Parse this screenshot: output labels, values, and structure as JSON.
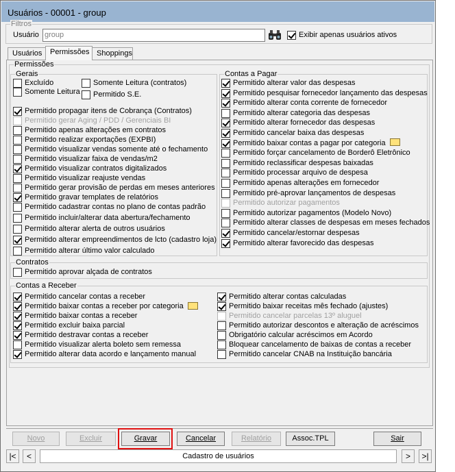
{
  "window": {
    "title": "Usuários - 00001 - group"
  },
  "filtros": {
    "legend": "Filtros",
    "usuario_label": "Usuário",
    "usuario_value": "group",
    "ativos_label": "Exibir apenas usuários ativos",
    "ativos_checked": true
  },
  "tabs": [
    "Usuários",
    "Permissões",
    "Shoppings"
  ],
  "permissoes": {
    "legend": "Permissões",
    "gerais": {
      "legend": "Gerais",
      "top": [
        {
          "label": "Excluído",
          "checked": false
        },
        {
          "label": "Somente Leitura",
          "checked": false
        },
        {
          "label": "Somente Leitura (contratos)",
          "checked": false
        },
        {
          "label": "Permitido S.E.",
          "checked": false
        }
      ],
      "items": [
        {
          "label": "Permitido propagar itens de Cobrança (Contratos)",
          "checked": true,
          "disabled": false
        },
        {
          "label": "Permitido gerar Aging / PDD / Gerenciais BI",
          "checked": false,
          "disabled": true
        },
        {
          "label": "Permitido apenas alterações em contratos",
          "checked": false,
          "disabled": false
        },
        {
          "label": "Permitido realizar exportações (EXPBI)",
          "checked": false,
          "disabled": false
        },
        {
          "label": "Permitido visualizar vendas somente até o fechamento",
          "checked": false,
          "disabled": false
        },
        {
          "label": "Permitido visualizar faixa de vendas/m2",
          "checked": false,
          "disabled": false
        },
        {
          "label": "Permitido visualizar contratos digitalizados",
          "checked": true,
          "disabled": false
        },
        {
          "label": "Permitido visualizar reajuste vendas",
          "checked": false,
          "disabled": false
        },
        {
          "label": "Permitido gerar provisão de perdas em meses anteriores",
          "checked": false,
          "disabled": false
        },
        {
          "label": "Permitido gravar templates de relatórios",
          "checked": true,
          "disabled": false
        },
        {
          "label": "Permitido cadastrar contas no plano de contas padrão",
          "checked": false,
          "disabled": false
        },
        {
          "label": "Permitido incluir/alterar data abertura/fechamento",
          "checked": false,
          "disabled": false
        },
        {
          "label": "Permitido alterar alerta de outros usuários",
          "checked": false,
          "disabled": false
        },
        {
          "label": "Permitido alterar empreendimentos de lcto (cadastro loja)",
          "checked": true,
          "disabled": false
        },
        {
          "label": "Permitido alterar último valor calculado",
          "checked": false,
          "disabled": false
        }
      ]
    },
    "contas_pagar": {
      "legend": "Contas a Pagar",
      "items": [
        {
          "label": "Permitido alterar valor das despesas",
          "checked": true,
          "disabled": false
        },
        {
          "label": "Permitido pesquisar fornecedor lançamento das despesas",
          "checked": true,
          "disabled": false
        },
        {
          "label": "Permitido alterar conta corrente de fornecedor",
          "checked": true,
          "disabled": false
        },
        {
          "label": "Permitido alterar categoria das despesas",
          "checked": false,
          "disabled": false
        },
        {
          "label": "Permitido alterar fornecedor das despesas",
          "checked": true,
          "disabled": false
        },
        {
          "label": "Permitido cancelar baixa das despesas",
          "checked": true,
          "disabled": false
        },
        {
          "label": "Permitido baixar contas a pagar por categoria",
          "checked": true,
          "disabled": false,
          "folder": true
        },
        {
          "label": "Permitido forçar cancelamento de Borderô Eletrônico",
          "checked": false,
          "disabled": false
        },
        {
          "label": "Permitido reclassificar despesas baixadas",
          "checked": false,
          "disabled": false
        },
        {
          "label": "Permitido processar arquivo de despesa",
          "checked": false,
          "disabled": false
        },
        {
          "label": "Permitido apenas alterações em fornecedor",
          "checked": false,
          "disabled": false
        },
        {
          "label": "Permitido pré-aprovar lançamentos de despesas",
          "checked": false,
          "disabled": false
        },
        {
          "label": "Permitido autorizar pagamentos",
          "checked": false,
          "disabled": true
        },
        {
          "label": "Permitido autorizar pagamentos (Modelo Novo)",
          "checked": false,
          "disabled": false
        },
        {
          "label": "Permitido alterar classes de despesas em meses fechados",
          "checked": false,
          "disabled": false
        },
        {
          "label": "Permitido cancelar/estornar despesas",
          "checked": true,
          "disabled": false
        },
        {
          "label": "Permitido alterar favorecido das despesas",
          "checked": true,
          "disabled": false
        }
      ]
    },
    "contratos": {
      "legend": "Contratos",
      "items": [
        {
          "label": "Permitido aprovar alçada de contratos",
          "checked": false,
          "disabled": false
        }
      ]
    },
    "contas_receber": {
      "legend": "Contas a Receber",
      "left": [
        {
          "label": "Permitido cancelar contas a receber",
          "checked": true,
          "disabled": false
        },
        {
          "label": "Permitido baixar contas a receber por categoria",
          "checked": true,
          "disabled": false,
          "folder": true
        },
        {
          "label": "Permitido baixar contas a receber",
          "checked": true,
          "disabled": false
        },
        {
          "label": "Permitido excluir baixa parcial",
          "checked": true,
          "disabled": false
        },
        {
          "label": "Permitido destravar contas a receber",
          "checked": true,
          "disabled": false
        },
        {
          "label": "Permitido visualizar alerta boleto sem remessa",
          "checked": false,
          "disabled": false
        },
        {
          "label": "Permitido alterar data acordo e lançamento manual",
          "checked": true,
          "disabled": false
        }
      ],
      "right": [
        {
          "label": "Permitido alterar contas calculadas",
          "checked": true,
          "disabled": false
        },
        {
          "label": "Permitido baixar receitas mês fechado (ajustes)",
          "checked": true,
          "disabled": false
        },
        {
          "label": "Permitido cancelar parcelas 13º aluguel",
          "checked": false,
          "disabled": true
        },
        {
          "label": "Permitido autorizar descontos e alteração de acréscimos",
          "checked": false,
          "disabled": false
        },
        {
          "label": "Obrigatório calcular acréscimos em Acordo",
          "checked": false,
          "disabled": false
        },
        {
          "label": "Bloquear cancelamento de baixas de contas a receber",
          "checked": false,
          "disabled": false
        },
        {
          "label": "Permitido cancelar CNAB na Instituição bancária",
          "checked": false,
          "disabled": false
        }
      ]
    }
  },
  "buttons": {
    "novo": "Novo",
    "excluir": "Excluir",
    "gravar": "Gravar",
    "cancelar": "Cancelar",
    "relatorio": "Relatório",
    "assoc": "Assoc.TPL",
    "sair": "Sair"
  },
  "navigator": {
    "first": "|<",
    "prev": "<",
    "caption": "Cadastro de usuários",
    "next": ">",
    "last": ">|"
  },
  "colors": {
    "titlebar": "#99b4d1",
    "highlight": "#e01010",
    "window": "#f0f0f0"
  }
}
